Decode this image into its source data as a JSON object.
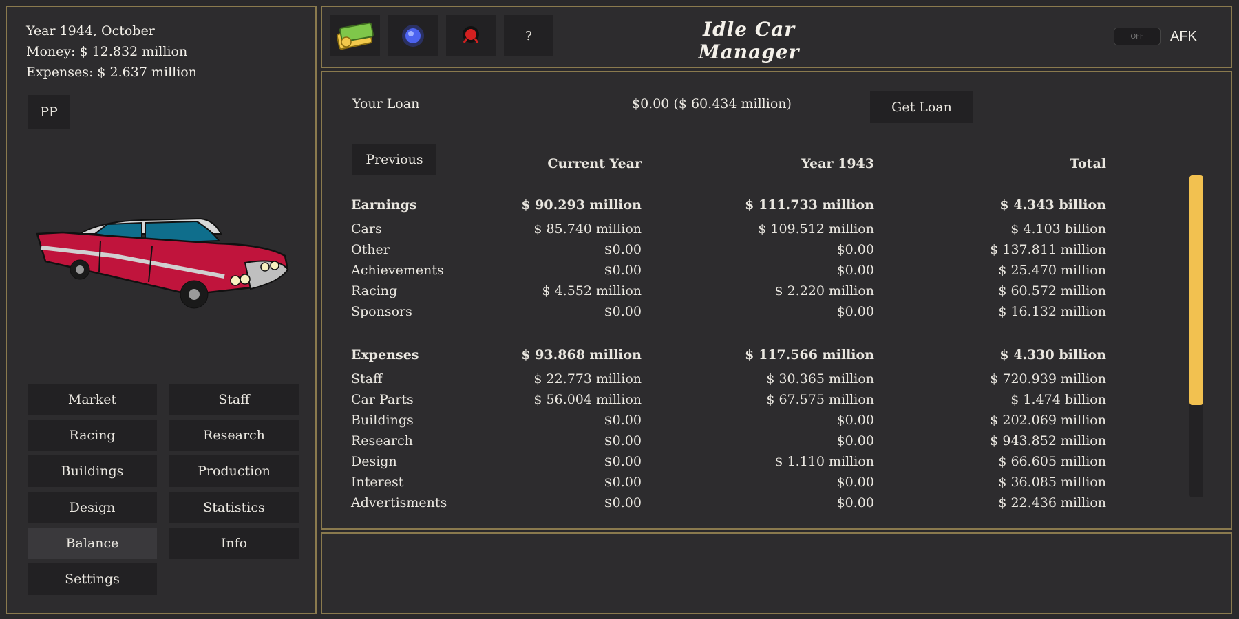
{
  "status": {
    "date": "Year 1944, October",
    "money": "Money: $ 12.832 million",
    "expenses": "Expenses: $ 2.637 million"
  },
  "pp_button": "PP",
  "nav": {
    "market": "Market",
    "staff": "Staff",
    "racing": "Racing",
    "research": "Research",
    "buildings": "Buildings",
    "production": "Production",
    "design": "Design",
    "statistics": "Statistics",
    "balance": "Balance",
    "info": "Info",
    "settings": "Settings"
  },
  "toolbar": {
    "icons": [
      "money-icon",
      "blue-orb-icon",
      "red-badge-icon",
      "help-icon"
    ],
    "help_label": "?",
    "title": "Idle Car Manager",
    "afk_toggle": "OFF",
    "afk_label": "AFK"
  },
  "loan": {
    "label": "Your Loan",
    "value": "$0.00 ($ 60.434 million)",
    "button": "Get Loan"
  },
  "balance": {
    "previous_button": "Previous",
    "headers": [
      "Current Year",
      "Year 1943",
      "Total"
    ],
    "earnings": {
      "label": "Earnings",
      "values": [
        "$ 90.293 million",
        "$ 111.733 million",
        "$ 4.343 billion"
      ],
      "rows": [
        {
          "label": "Cars",
          "values": [
            "$ 85.740 million",
            "$ 109.512 million",
            "$ 4.103 billion"
          ]
        },
        {
          "label": "Other",
          "values": [
            "$0.00",
            "$0.00",
            "$ 137.811 million"
          ]
        },
        {
          "label": "Achievements",
          "values": [
            "$0.00",
            "$0.00",
            "$ 25.470 million"
          ]
        },
        {
          "label": "Racing",
          "values": [
            "$ 4.552 million",
            "$ 2.220 million",
            "$ 60.572 million"
          ]
        },
        {
          "label": "Sponsors",
          "values": [
            "$0.00",
            "$0.00",
            "$ 16.132 million"
          ]
        }
      ]
    },
    "expenses": {
      "label": "Expenses",
      "values": [
        "$ 93.868 million",
        "$ 117.566 million",
        "$ 4.330 billion"
      ],
      "rows": [
        {
          "label": "Staff",
          "values": [
            "$ 22.773 million",
            "$ 30.365 million",
            "$ 720.939 million"
          ]
        },
        {
          "label": "Car Parts",
          "values": [
            "$ 56.004 million",
            "$ 67.575 million",
            "$ 1.474 billion"
          ]
        },
        {
          "label": "Buildings",
          "values": [
            "$0.00",
            "$0.00",
            "$ 202.069 million"
          ]
        },
        {
          "label": "Research",
          "values": [
            "$0.00",
            "$0.00",
            "$ 943.852 million"
          ]
        },
        {
          "label": "Design",
          "values": [
            "$0.00",
            "$ 1.110 million",
            "$ 66.605 million"
          ]
        },
        {
          "label": "Interest",
          "values": [
            "$0.00",
            "$0.00",
            "$ 36.085 million"
          ]
        },
        {
          "label": "Advertisments",
          "values": [
            "$0.00",
            "$0.00",
            "$ 22.436 million"
          ]
        }
      ]
    }
  },
  "colors": {
    "border": "#8a7a4e",
    "panel": "#2d2c2e",
    "button": "#222123",
    "scroll_thumb": "#f2c150",
    "car_body": "#c0143c",
    "car_window": "#0f6e8c"
  }
}
